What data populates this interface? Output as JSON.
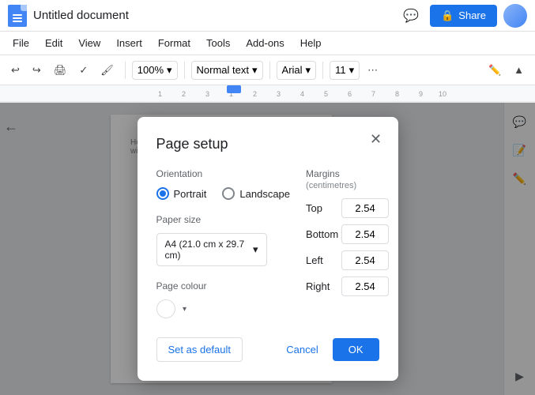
{
  "app": {
    "title": "Untitled document"
  },
  "titlebar": {
    "title": "Untitled document",
    "share_label": "Share"
  },
  "menubar": {
    "items": [
      "File",
      "Edit",
      "View",
      "Insert",
      "Format",
      "Tools",
      "Add-ons",
      "Help"
    ]
  },
  "toolbar": {
    "zoom": "100%",
    "style": "Normal text",
    "font": "Arial",
    "size": "11"
  },
  "dialog": {
    "title": "Page setup",
    "orientation_label": "Orientation",
    "portrait_label": "Portrait",
    "landscape_label": "Landscape",
    "paper_size_label": "Paper size",
    "paper_size_value": "A4 (21.0 cm x 29.7 cm)",
    "page_colour_label": "Page colour",
    "margins_label": "Margins",
    "margins_unit": "(centimetres)",
    "top_label": "Top",
    "top_value": "2.54",
    "bottom_label": "Bottom",
    "bottom_value": "2.54",
    "left_label": "Left",
    "left_value": "2.54",
    "right_label": "Right",
    "right_value": "2.54",
    "set_default_label": "Set as default",
    "cancel_label": "Cancel",
    "ok_label": "OK"
  },
  "doc": {
    "content_line1": "Headings that you add to the do...",
    "content_line2": "will appear here."
  }
}
